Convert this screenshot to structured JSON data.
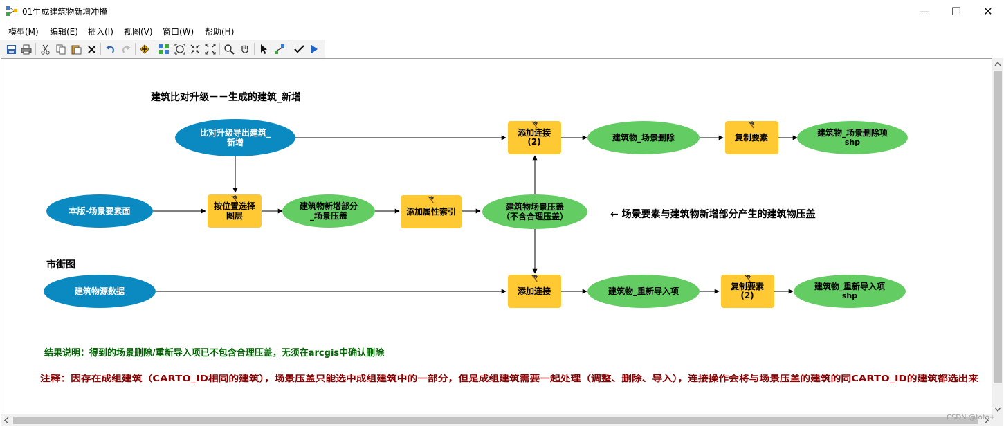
{
  "window": {
    "title": "01生成建筑物新增冲撞",
    "controls": {
      "minimize": "—",
      "maximize": "☐",
      "close": "✕"
    }
  },
  "menu": [
    {
      "label": "模型(M)"
    },
    {
      "label": "编辑(E)"
    },
    {
      "label": "插入(I)"
    },
    {
      "label": "视图(V)"
    },
    {
      "label": "窗口(W)"
    },
    {
      "label": "帮助(H)"
    }
  ],
  "toolbar": {
    "icons": [
      "save-icon",
      "print-icon",
      "cut-icon",
      "copy-icon",
      "paste-icon",
      "delete-icon",
      "undo-icon",
      "redo-icon",
      "add-data-icon",
      "auto-layout-icon",
      "full-extent-icon",
      "zoom-in-fixed-icon",
      "zoom-out-fixed-icon",
      "zoom-in-icon",
      "pan-icon",
      "select-icon",
      "connect-icon",
      "validate-icon",
      "run-icon"
    ]
  },
  "diagram": {
    "title": "建筑比对升级－－生成的建筑_新增",
    "section_label": "市街图",
    "annotation": "←  场景要素与建筑物新增部分产生的建筑物压盖",
    "nodes": {
      "n_export": {
        "line1": "比对升级导出建筑_",
        "line2": "新增"
      },
      "n_scene": {
        "line1": "本版-场景要素面",
        "line2": ""
      },
      "n_select": {
        "line1": "按位置选择",
        "line2": "图层"
      },
      "n_newpart": {
        "line1": "建筑物新增部分",
        "line2": "_场景压盖"
      },
      "n_attr_index": {
        "line1": "添加属性索引",
        "line2": ""
      },
      "n_overlap": {
        "line1": "建筑物场景压盖",
        "line2": "（不含合理压盖）"
      },
      "n_join2": {
        "line1": "添加连接",
        "line2": "(2)"
      },
      "n_scene_del": {
        "line1": "建筑物_场景删除",
        "line2": ""
      },
      "n_copy": {
        "line1": "复制要素",
        "line2": ""
      },
      "n_scene_del_shp": {
        "line1": "建筑物_场景删除项",
        "line2": "shp"
      },
      "n_source": {
        "line1": "建筑物源数据",
        "line2": ""
      },
      "n_join": {
        "line1": "添加连接",
        "line2": ""
      },
      "n_reimport": {
        "line1": "建筑物_重新导入项",
        "line2": ""
      },
      "n_copy2": {
        "line1": "复制要素",
        "line2": "(2)"
      },
      "n_reimport_shp": {
        "line1": "建筑物_重新导入项",
        "line2": "shp"
      }
    },
    "note_result": "结果说明：得到的场景删除/重新导入项已不包含合理压盖，无须在arcgis中确认删除",
    "note_remark": "注释：因存在成组建筑（CARTO_ID相同的建筑），场景压盖只能选中成组建筑中的一部分，但是成组建筑需要一起处理（调整、删除、导入），连接操作会将与场景压盖的建筑的同CARTO_ID的建筑都选出来",
    "colors": {
      "input": "#0b8ac2",
      "tool": "#ffc933",
      "output": "#63cc63",
      "note_result": "#006400",
      "note_remark": "#8b0000"
    }
  },
  "watermark": "CSDN @toto+"
}
